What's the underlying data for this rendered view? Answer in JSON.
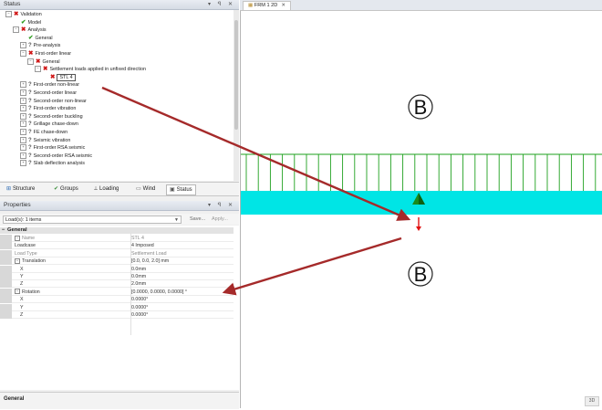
{
  "status_panel": {
    "title": "Status",
    "controls": "▾ ꟼ ✕",
    "tree": [
      {
        "label": "Validation",
        "icon": "x",
        "indent": 0,
        "exp": "−"
      },
      {
        "label": "Model",
        "icon": "ok",
        "indent": 1,
        "exp": ""
      },
      {
        "label": "Analysis",
        "icon": "x",
        "indent": 1,
        "exp": "−"
      },
      {
        "label": "General",
        "icon": "ok",
        "indent": 2,
        "exp": ""
      },
      {
        "label": "Pre-analysis",
        "icon": "q",
        "indent": 2,
        "exp": "+"
      },
      {
        "label": "First-order linear",
        "icon": "x",
        "indent": 2,
        "exp": "−"
      },
      {
        "label": "General",
        "icon": "x",
        "indent": 3,
        "exp": "−"
      },
      {
        "label": "Settlement loads applied in unfixed direction",
        "icon": "x",
        "indent": 4,
        "exp": "−"
      },
      {
        "label": "STL 4",
        "icon": "x",
        "indent": 5,
        "exp": "",
        "selected": true
      },
      {
        "label": "First-order non-linear",
        "icon": "q",
        "indent": 2,
        "exp": "+"
      },
      {
        "label": "Second-order linear",
        "icon": "q",
        "indent": 2,
        "exp": "+"
      },
      {
        "label": "Second-order non-linear",
        "icon": "q",
        "indent": 2,
        "exp": "+"
      },
      {
        "label": "First-order vibration",
        "icon": "q",
        "indent": 2,
        "exp": "+"
      },
      {
        "label": "Second-order buckling",
        "icon": "q",
        "indent": 2,
        "exp": "+"
      },
      {
        "label": "Grillage chase-down",
        "icon": "q",
        "indent": 2,
        "exp": "+"
      },
      {
        "label": "FE chase-down",
        "icon": "q",
        "indent": 2,
        "exp": "+"
      },
      {
        "label": "Seismic vibration",
        "icon": "q",
        "indent": 2,
        "exp": "+"
      },
      {
        "label": "First-order RSA seismic",
        "icon": "q",
        "indent": 2,
        "exp": "+"
      },
      {
        "label": "Second-order RSA seismic",
        "icon": "q",
        "indent": 2,
        "exp": "+"
      },
      {
        "label": "Slab deflection analysis",
        "icon": "q",
        "indent": 2,
        "exp": "+"
      }
    ]
  },
  "tabs": [
    {
      "label": "Structure",
      "icon": "⊞",
      "icon_color": "#2f6db5"
    },
    {
      "label": "Groups",
      "icon": "✔",
      "icon_color": "#3a8f3a"
    },
    {
      "label": "Loading",
      "icon": "⟂",
      "icon_color": "#555555"
    },
    {
      "label": "Wind",
      "icon": "▭",
      "icon_color": "#555555"
    },
    {
      "label": "Status",
      "icon": "▣",
      "icon_color": "#555555"
    }
  ],
  "properties_panel": {
    "title": "Properties",
    "controls": "▾ ꟼ ✕",
    "selector": "Load(s): 1 items",
    "save_label": "Save...",
    "apply_label": "Apply...",
    "category": "General",
    "rows": [
      {
        "name": "Name",
        "value": "STL 4",
        "dim": true,
        "expander": "+",
        "sub": false
      },
      {
        "name": "Loadcase",
        "value": "4 Imposed",
        "dim": false,
        "expander": "",
        "sub": false
      },
      {
        "name": "Load Type",
        "value": "Settlement Load",
        "dim": true,
        "expander": "",
        "sub": false
      },
      {
        "name": "Translation",
        "value": "[0.0, 0.0, 2.0] mm",
        "dim": false,
        "expander": "−",
        "sub": false
      },
      {
        "name": "X",
        "value": "0.0mm",
        "dim": false,
        "expander": "",
        "sub": true
      },
      {
        "name": "Y",
        "value": "0.0mm",
        "dim": false,
        "expander": "",
        "sub": true
      },
      {
        "name": "Z",
        "value": "2.0mm",
        "dim": false,
        "expander": "",
        "sub": true
      },
      {
        "name": "Rotation",
        "value": "[0.0000, 0.0000, 0.0000] °",
        "dim": false,
        "expander": "−",
        "sub": false
      },
      {
        "name": "X",
        "value": "0.0000°",
        "dim": false,
        "expander": "",
        "sub": true
      },
      {
        "name": "Y",
        "value": "0.0000°",
        "dim": false,
        "expander": "",
        "sub": true
      },
      {
        "name": "Z",
        "value": "0.0000°",
        "dim": false,
        "expander": "",
        "sub": true
      }
    ],
    "description_title": "General"
  },
  "document": {
    "tab_label": "FRM 1 2D",
    "close_glyph": "✕",
    "section_label": "B",
    "view_badge": "3D",
    "colors": {
      "beam": "#00e5e5",
      "load_lines": "#1ea01e",
      "support": "#1a8a1a",
      "settlement_arrow": "#e01010",
      "annotation_arrow": "#a52a2a"
    }
  }
}
